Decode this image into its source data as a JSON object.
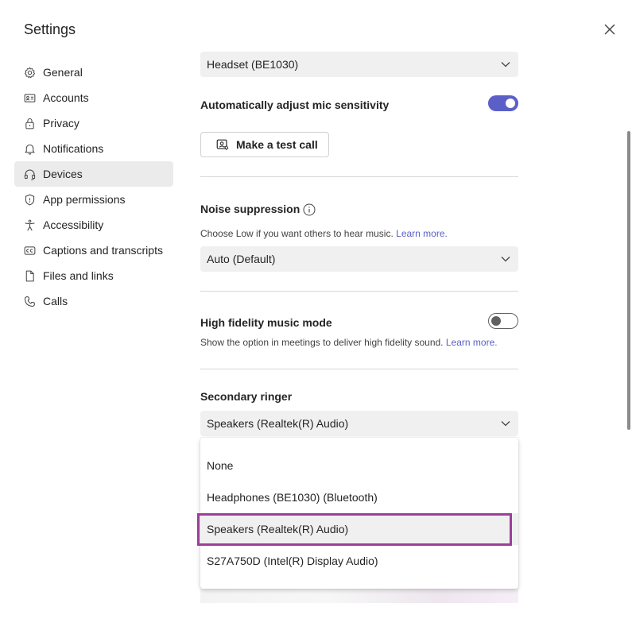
{
  "window": {
    "title": "Settings"
  },
  "sidebar": {
    "items": [
      {
        "label": "General",
        "icon": "gear-icon"
      },
      {
        "label": "Accounts",
        "icon": "id-card-icon"
      },
      {
        "label": "Privacy",
        "icon": "lock-icon"
      },
      {
        "label": "Notifications",
        "icon": "bell-icon"
      },
      {
        "label": "Devices",
        "icon": "headset-icon",
        "active": true
      },
      {
        "label": "App permissions",
        "icon": "shield-icon"
      },
      {
        "label": "Accessibility",
        "icon": "accessibility-icon"
      },
      {
        "label": "Captions and transcripts",
        "icon": "cc-icon"
      },
      {
        "label": "Files and links",
        "icon": "document-icon"
      },
      {
        "label": "Calls",
        "icon": "phone-icon"
      }
    ]
  },
  "devices": {
    "microphone_value": "Headset (BE1030)",
    "auto_mic": {
      "label": "Automatically adjust mic sensitivity",
      "enabled": true
    },
    "test_call_label": "Make a test call",
    "noise": {
      "label": "Noise suppression",
      "description": "Choose Low if you want others to hear music.",
      "link": "Learn more.",
      "value": "Auto (Default)"
    },
    "hifi": {
      "label": "High fidelity music mode",
      "description": "Show the option in meetings to deliver high fidelity sound.",
      "link": "Learn more.",
      "enabled": false
    },
    "secondary_ringer": {
      "label": "Secondary ringer",
      "value": "Speakers (Realtek(R) Audio)",
      "options": [
        "None",
        "Headphones (BE1030) (Bluetooth)",
        "Speakers (Realtek(R) Audio)",
        "S27A750D (Intel(R) Display Audio)"
      ],
      "selected_index": 2
    }
  },
  "colors": {
    "accent": "#5b5fc7",
    "highlight": "#9b3f99",
    "active_nav": "#ebebeb"
  }
}
